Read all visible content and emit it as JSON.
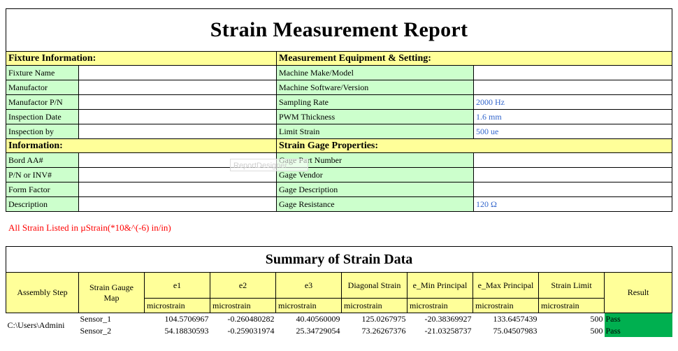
{
  "report": {
    "title": "Strain Measurement Report",
    "fixture_header": "Fixture Information:",
    "equipment_header": "Measurement Equipment & Setting:",
    "info_header": "Information:",
    "gage_header": "Strain Gage Properties:",
    "fixture_rows": [
      {
        "label": "Fixture Name",
        "value": ""
      },
      {
        "label": "Manufactor",
        "value": ""
      },
      {
        "label": "Manufactor P/N",
        "value": ""
      },
      {
        "label": "Inspection Date",
        "value": ""
      },
      {
        "label": "Inspection by",
        "value": ""
      }
    ],
    "equipment_rows": [
      {
        "label": "Machine Make/Model",
        "value": ""
      },
      {
        "label": "Machine Software/Version",
        "value": ""
      },
      {
        "label": "Sampling Rate",
        "value": "2000 Hz"
      },
      {
        "label": "PWM Thickness",
        "value": "1.6 mm"
      },
      {
        "label": "Limit Strain",
        "value": "500 ue"
      }
    ],
    "info_rows": [
      {
        "label": "Bord AA#",
        "value": ""
      },
      {
        "label": "P/N or INV#",
        "value": ""
      },
      {
        "label": "Form Factor",
        "value": ""
      },
      {
        "label": "Description",
        "value": ""
      }
    ],
    "gage_rows": [
      {
        "label": "Gage Part Number",
        "value": ""
      },
      {
        "label": "Gage Vendor",
        "value": ""
      },
      {
        "label": "Gage Description",
        "value": ""
      },
      {
        "label": "Gage Resistance",
        "value": "120 Ω"
      }
    ],
    "watermark": "ReportDesigner",
    "note": "All Strain Listed in µStrain(*10&^(-6) in/in)"
  },
  "summary": {
    "title": "Summary of Strain Data",
    "headers": [
      "Assembly Step",
      "Strain Gauge Map",
      "e1",
      "e2",
      "e3",
      "Diagonal Strain",
      "e_Min Principal",
      "e_Max Principal",
      "Strain Limit",
      "Result"
    ],
    "units": [
      "microstrain",
      "microstrain",
      "microstrain",
      "microstrain",
      "microstrain",
      "microstrain",
      "microstrain"
    ],
    "assembly_step": "C:\\Users\\Admini",
    "rows": [
      {
        "map": "Sensor_1",
        "e1": "104.5706967",
        "e2": "-0.260480282",
        "e3": "40.40560009",
        "diag": "125.0267975",
        "emin": "-20.38369927",
        "emax": "133.6457439",
        "limit": "500",
        "result": "Pass"
      },
      {
        "map": "Sensor_2",
        "e1": "54.18830593",
        "e2": "-0.259031974",
        "e3": "25.34729054",
        "diag": "73.26267376",
        "emin": "-21.03258737",
        "emax": "75.04507983",
        "limit": "500",
        "result": "Pass"
      }
    ]
  }
}
